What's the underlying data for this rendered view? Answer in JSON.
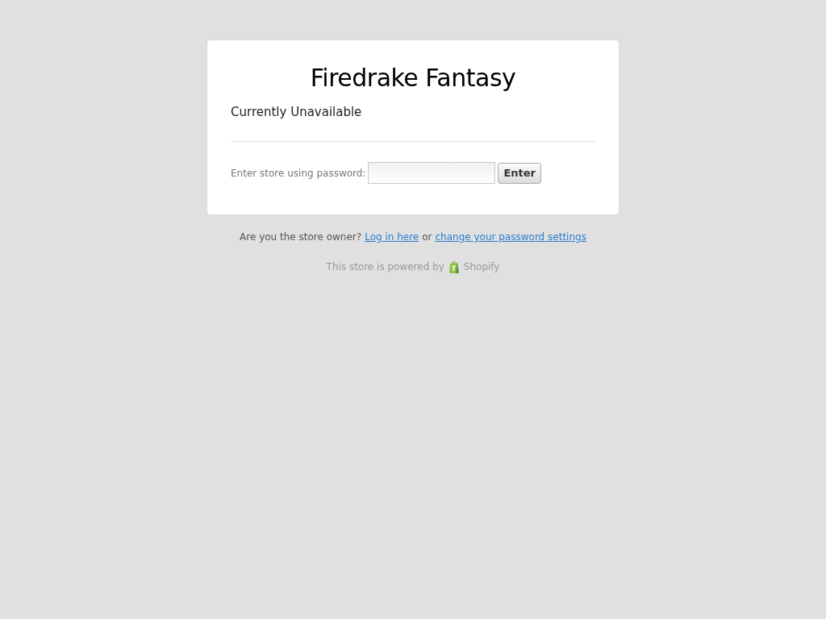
{
  "store_name": "Firedrake Fantasy",
  "status": "Currently Unavailable",
  "password_form": {
    "label": "Enter store using password:",
    "button": "Enter"
  },
  "owner_line": {
    "question": "Are you the store owner?",
    "login_link": "Log in here",
    "joiner": "or",
    "settings_link": "change your password settings"
  },
  "powered_by": {
    "text": "This store is powered by",
    "brand": "Shopify"
  }
}
